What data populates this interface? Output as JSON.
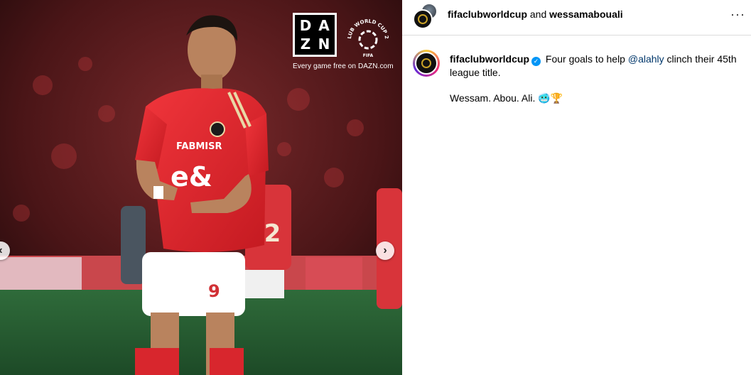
{
  "media": {
    "dazn_letters": [
      "D",
      "A",
      "Z",
      "N"
    ],
    "dazn_tagline": "Every game free on DAZN.com",
    "cwc_logo_text": "CLUB WORLD CUP 25",
    "cwc_logo_sub": "FIFA",
    "shirt_sponsor": "FABMISR",
    "shirt_number": "9",
    "background_player_number": "22",
    "prev_icon": "chevron-left-icon",
    "next_icon": "chevron-right-icon",
    "prev_glyph": "‹",
    "next_glyph": "›"
  },
  "header": {
    "user1": "fifaclubworldcup",
    "joiner": " and ",
    "user2": "wessamabouali",
    "more_glyph": "···"
  },
  "caption": {
    "username": "fifaclubworldcup",
    "verified_glyph": "✓",
    "text_before_mention": "Four goals to help ",
    "mention": "@alahly",
    "text_after_mention": " clinch their 45th league title.",
    "line2": "Wessam. Abou. Ali.",
    "line2_emojis": "🥶🏆"
  },
  "colors": {
    "verified": "#0095f6",
    "mention": "#00376b",
    "jersey_red": "#e2242b",
    "gold": "#c9a227"
  }
}
